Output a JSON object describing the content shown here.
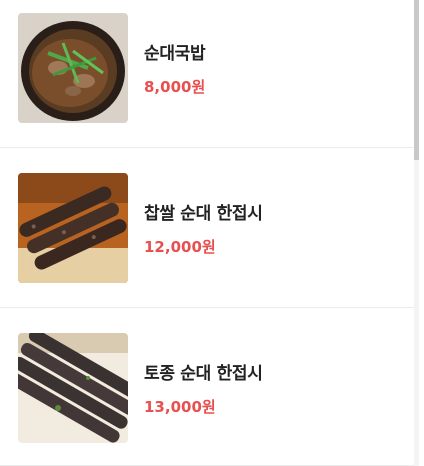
{
  "menu": {
    "items": [
      {
        "name": "순대국밥",
        "price": "8,000원",
        "image": "sundae-gukbap-photo"
      },
      {
        "name": "찹쌀 순대 한접시",
        "price": "12,000원",
        "image": "glutinous-rice-sundae-plate-photo"
      },
      {
        "name": "토종 순대 한접시",
        "price": "13,000원",
        "image": "native-sundae-plate-photo"
      }
    ]
  },
  "colors": {
    "price": "#e84f4f",
    "name": "#222222",
    "divider": "#ececec"
  }
}
